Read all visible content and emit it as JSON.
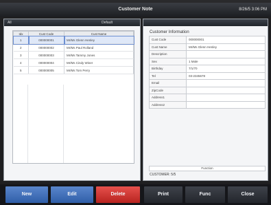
{
  "window": {
    "title": "Customer Note",
    "datetime": "8/26/5 3:06 PM"
  },
  "left_header": {
    "filter": "All",
    "right_text": "Default"
  },
  "customer_list": {
    "columns": [
      "Idx",
      "Cust Code",
      "Cust Name"
    ],
    "rows": [
      {
        "idx": "1",
        "code": "000000001",
        "name": "Mr/Ms Glenn Henley"
      },
      {
        "idx": "2",
        "code": "000000002",
        "name": "Mr/Ms Paul Rolland"
      },
      {
        "idx": "3",
        "code": "000000003",
        "name": "Mr/Ms Tammy Jones"
      },
      {
        "idx": "4",
        "code": "000000004",
        "name": "Mr/Ms Cindy Winer"
      },
      {
        "idx": "5",
        "code": "000000005",
        "name": "Mr/Ms Tom Perry"
      }
    ],
    "selected_row": 0
  },
  "list_nav": [
    "«",
    "‹",
    "›",
    "»"
  ],
  "info_nav": [
    "«",
    "‹",
    "›",
    "»"
  ],
  "customer_info": {
    "title": "Customer Information",
    "fields": [
      {
        "label": "Cust Code",
        "value": "000000001"
      },
      {
        "label": "Cust Name",
        "value": "Mr/Ms Glenn Henley"
      },
      {
        "label": "Description",
        "value": ""
      },
      {
        "label": "Sex",
        "value": "1 Male"
      },
      {
        "label": "Birthday",
        "value": "7/1/70"
      },
      {
        "label": "Tel",
        "value": "03-2345678"
      },
      {
        "label": "Email",
        "value": ""
      },
      {
        "label": "ZipCode",
        "value": ""
      },
      {
        "label": "Address1",
        "value": ""
      },
      {
        "label": "Address2",
        "value": ""
      }
    ],
    "function_label": "Function",
    "count_text": "CUSTOMER: 5/5"
  },
  "toolbar": {
    "new_label": "New",
    "edit_label": "Edit",
    "delete_label": "Delete",
    "print_label": "Print",
    "func_label": "Func",
    "close_label": "Close"
  },
  "colors": {
    "primary": "#2f5ea8",
    "danger": "#b8231f",
    "dark": "#23262c"
  }
}
